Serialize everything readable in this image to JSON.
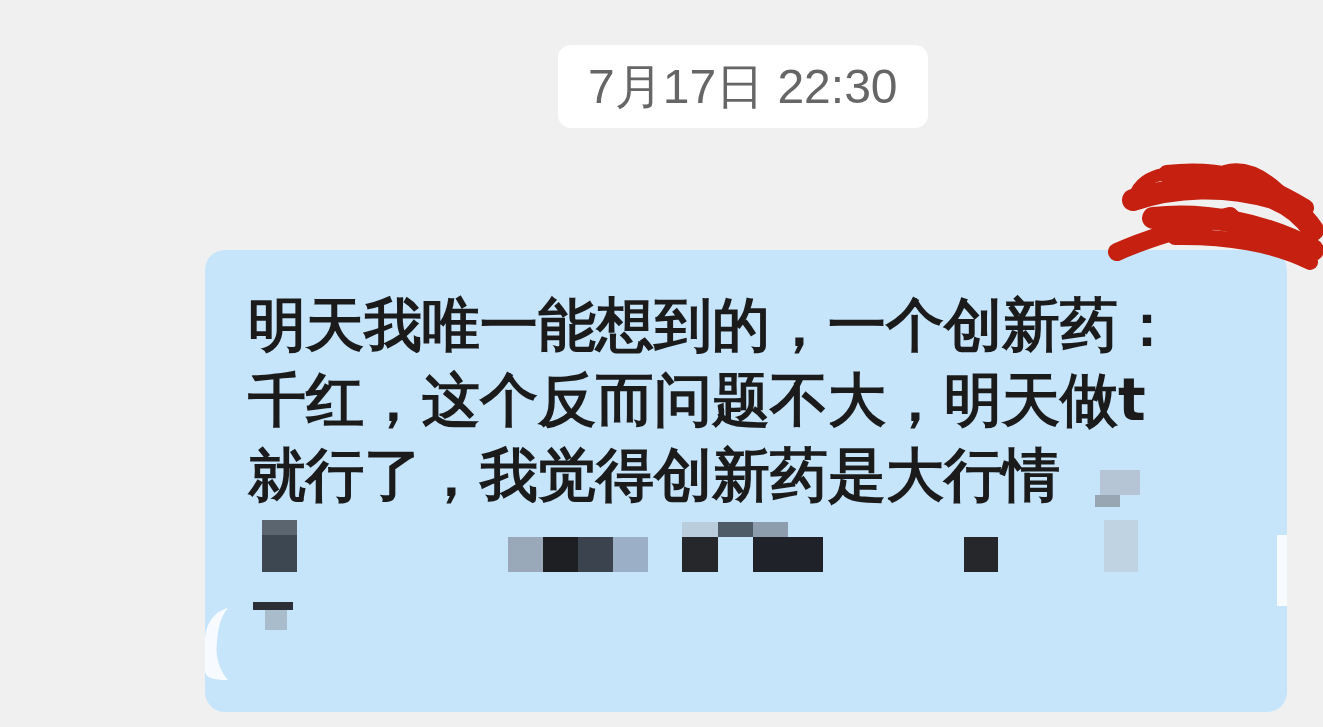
{
  "timestamp": "7月17日 22:30",
  "message": {
    "text": "明天我唯一能想到的，一个创新药：千红，这个反而问题不大，明天做t就行了，我觉得创新药是大行情",
    "redacted": true
  }
}
